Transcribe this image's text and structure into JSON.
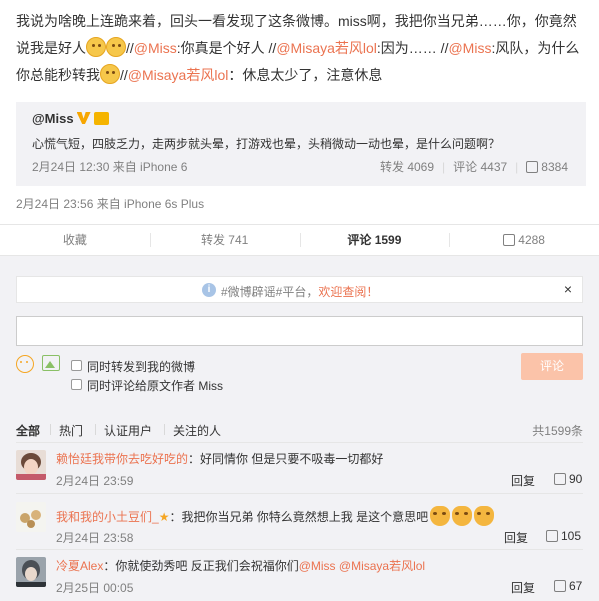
{
  "post": {
    "text_parts": [
      {
        "t": "我说为啥晚上连跪来着，回头一看发现了这条微博。miss啊，我把你当兄弟……你，你竟然说我是好人",
        "k": "plain"
      },
      {
        "t": "//",
        "k": "plain"
      },
      {
        "t": "@Miss",
        "k": "link"
      },
      {
        "t": ":你真是个好人 //",
        "k": "plain"
      },
      {
        "t": "@Misaya若风lol",
        "k": "link"
      },
      {
        "t": ":因为…… //",
        "k": "plain"
      },
      {
        "t": "@Miss",
        "k": "link"
      },
      {
        "t": ":风队，为什么你总能秒转我",
        "k": "plain"
      },
      {
        "t": "//",
        "k": "plain"
      },
      {
        "t": "@Misaya若风lol",
        "k": "link"
      },
      {
        "t": "：休息太少了，注意休息",
        "k": "plain"
      }
    ],
    "meta": "2月24日 23:56 来自 iPhone 6s Plus"
  },
  "repost": {
    "author": "@Miss",
    "text": "心慌气短，四肢乏力，走两步就头晕，打游戏也晕，头稍微动一动也晕，是什么问题啊？",
    "meta": "2月24日 12:30 来自 iPhone 6",
    "repost_label": "转发 4069",
    "comment_label": "评论 4437",
    "like_count": "8384"
  },
  "actions": {
    "collect": "收藏",
    "repost": "转发 741",
    "comment": "评论 1599",
    "like": "4288"
  },
  "notice": {
    "prefix": "#微博辟谣#平台，",
    "link": "欢迎查阅！",
    "close": "×"
  },
  "composer": {
    "also_repost": "同时转发到我的微博",
    "also_comment": "同时评论给原文作者 Miss",
    "submit": "评论"
  },
  "filters": {
    "all": "全部",
    "hot": "热门",
    "verified": "认证用户",
    "following": "关注的人",
    "total": "共1599条"
  },
  "comments": [
    {
      "user": "赖怡廷我带你去吃好吃的",
      "text": "：好同情你 但是只要不吸毒一切都好",
      "time": "2月24日 23:59",
      "reply": "回复",
      "likes": "90"
    },
    {
      "user": "我和我的小土豆们_",
      "text": "：我把你当兄弟 你特么竟然想上我 是这个意思吧",
      "time": "2月24日 23:58",
      "reply": "回复",
      "likes": "105"
    },
    {
      "user": "冷夏Alex",
      "text": "：你就使劲秀吧 反正我们会祝福你们",
      "mention1": "@Miss",
      "mention2": "@Misaya若风lol",
      "time": "2月25日 00:05",
      "reply": "回复",
      "likes": "67"
    }
  ],
  "colors": {
    "accent": "#eb7350",
    "panel": "#f2f2f5",
    "meta": "#808080"
  }
}
